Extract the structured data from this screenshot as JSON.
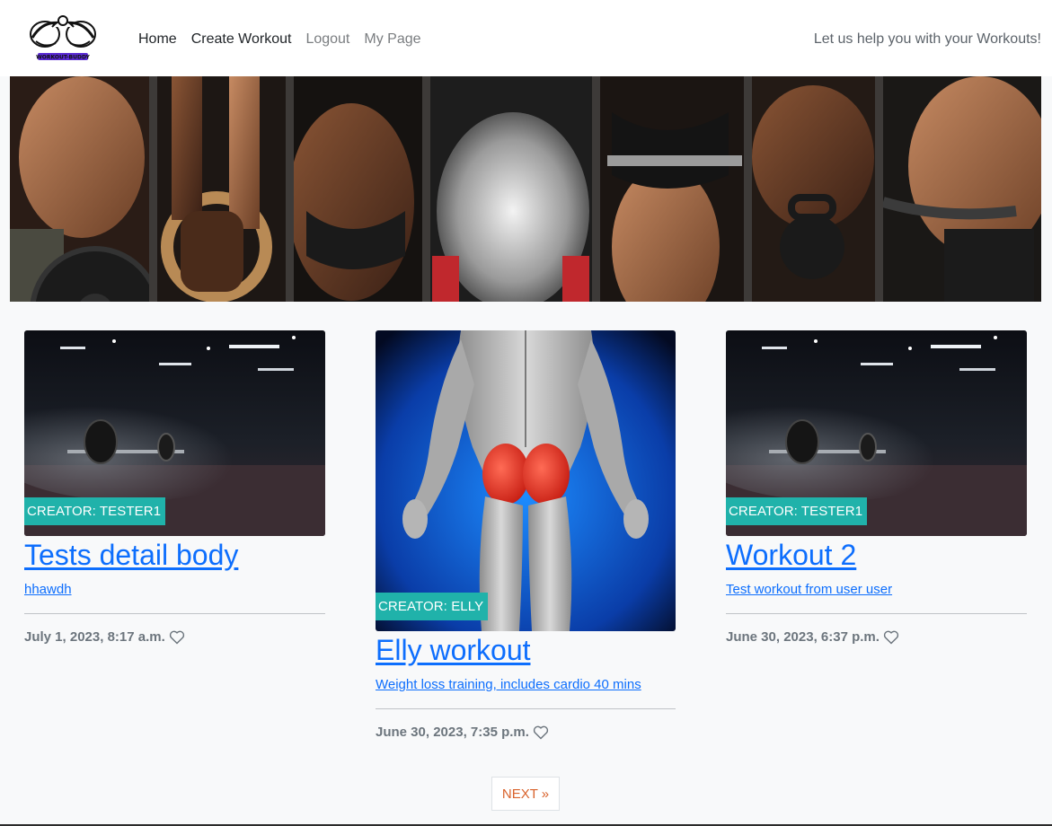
{
  "nav": {
    "logo_text": "WORKOUT-BUDDY",
    "links": [
      {
        "label": "Home"
      },
      {
        "label": "Create Workout"
      },
      {
        "label": "Logout"
      },
      {
        "label": "My Page"
      }
    ],
    "tagline": "Let us help you with your Workouts!"
  },
  "cards": [
    {
      "badge": "CREATOR: TESTER1",
      "title": "Tests detail body",
      "description": "hhawdh",
      "date": "July 1, 2023, 8:17 a.m."
    },
    {
      "badge": "CREATOR: ELLY",
      "title": "Elly workout",
      "description": "Weight loss training, includes cardio 40 mins",
      "date": "June 30, 2023, 7:35 p.m."
    },
    {
      "badge": "CREATOR: TESTER1",
      "title": "Workout 2",
      "description": "Test workout from user user",
      "date": "June 30, 2023, 6:37 p.m."
    }
  ],
  "pagination": {
    "next_label": "NEXT »"
  },
  "colors": {
    "accent": "#20b2aa",
    "link": "#0d6efd",
    "next": "#d9622b"
  }
}
